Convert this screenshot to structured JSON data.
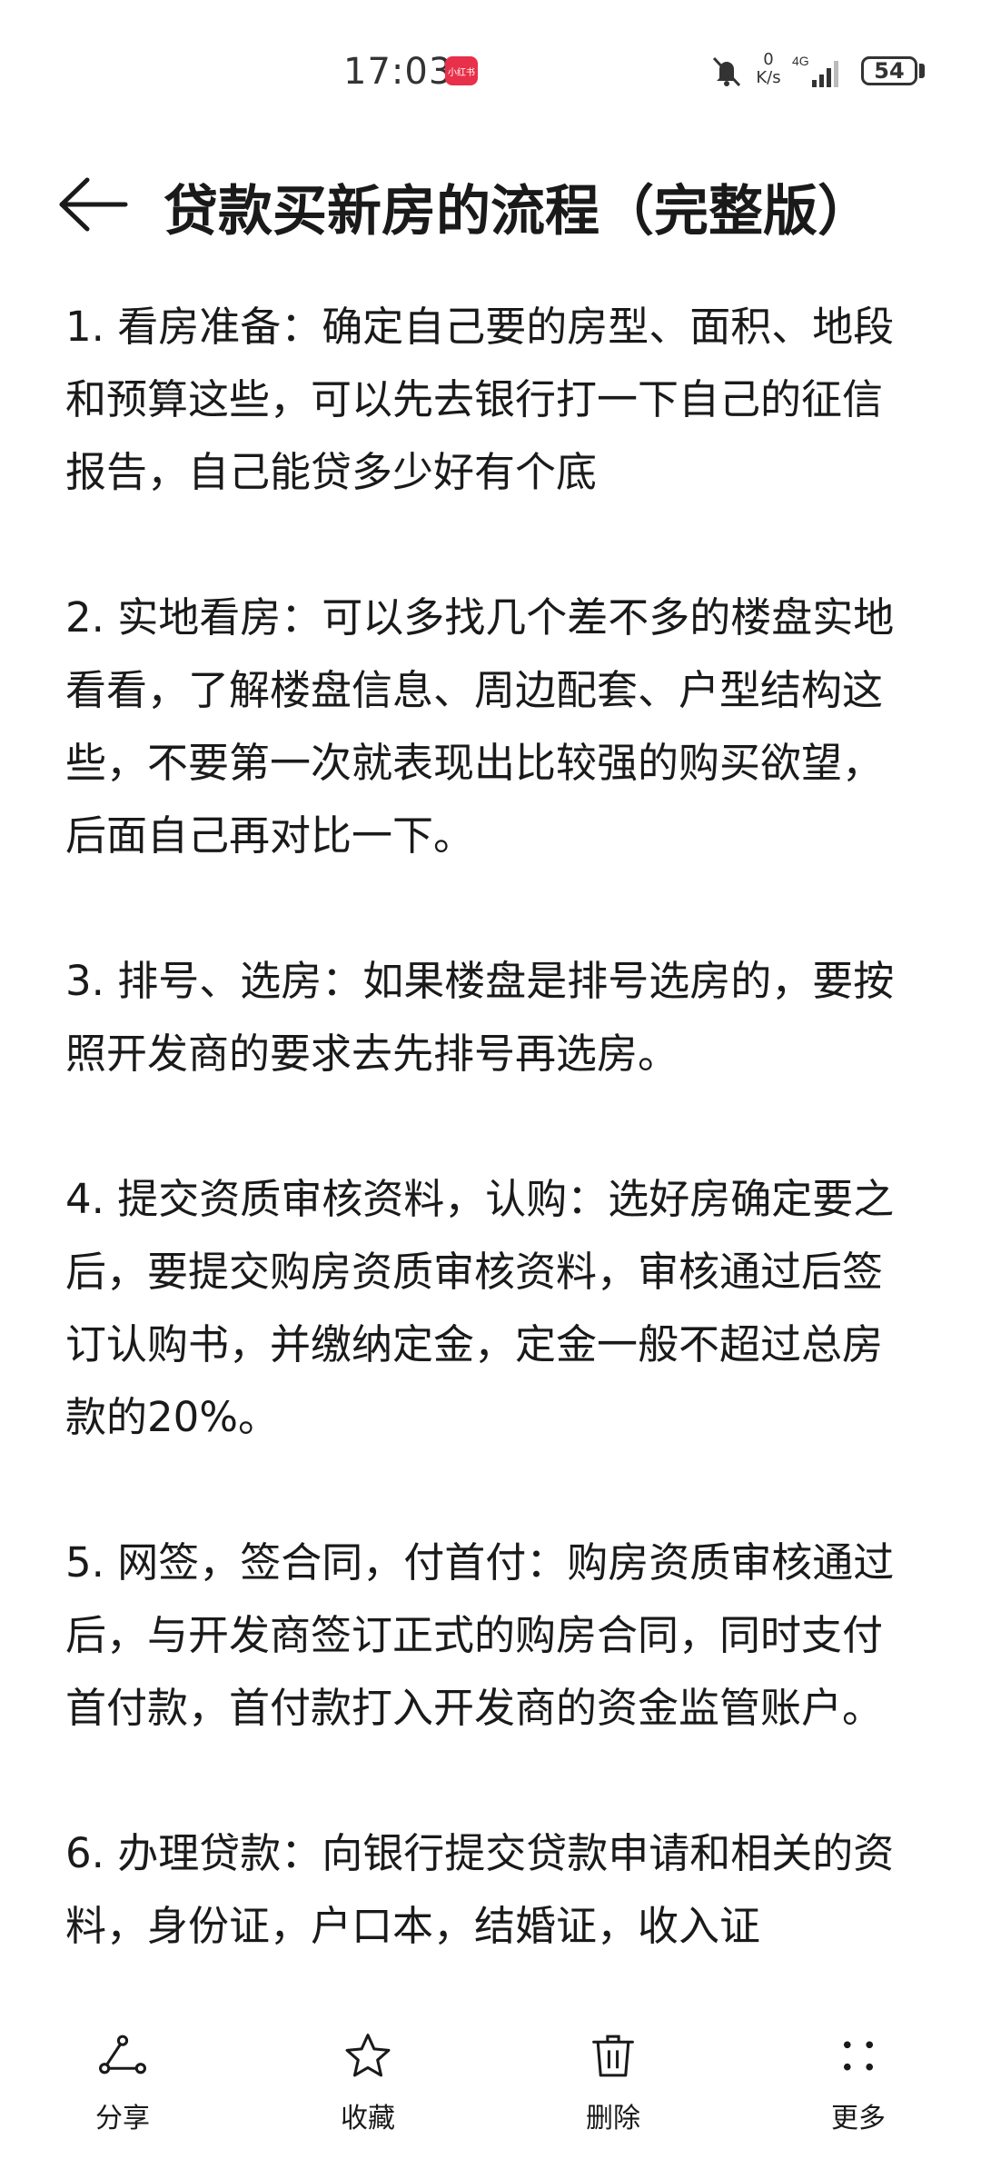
{
  "status": {
    "time": "17:03",
    "app_badge": "小红书",
    "net_speed_top": "0",
    "net_speed_bottom": "K/s",
    "network": "4G",
    "battery": "54"
  },
  "header": {
    "title": "贷款买新房的流程（完整版）"
  },
  "steps": [
    "1. 看房准备：确定自己要的房型、面积、地段和预算这些，可以先去银行打一下自己的征信报告，自己能贷多少好有个底",
    "2. 实地看房：可以多找几个差不多的楼盘实地看看，了解楼盘信息、周边配套、户型结构这些，不要第一次就表现出比较强的购买欲望，后面自己再对比一下。",
    "3. 排号、选房：如果楼盘是排号选房的，要按照开发商的要求去先排号再选房。",
    "4. 提交资质审核资料，认购：选好房确定要之后，要提交购房资质审核资料，审核通过后签订认购书，并缴纳定金，定金一般不超过总房款的20%。",
    "5. 网签，签合同，付首付：购房资质审核通过后，与开发商签订正式的购房合同，同时支付首付款，首付款打入开发商的资金监管账户。",
    "6. 办理贷款：向银行提交贷款申请和相关的资料，身份证，户口本，结婚证，收入证"
  ],
  "toolbar": {
    "share": "分享",
    "favorite": "收藏",
    "delete": "删除",
    "more": "更多"
  }
}
